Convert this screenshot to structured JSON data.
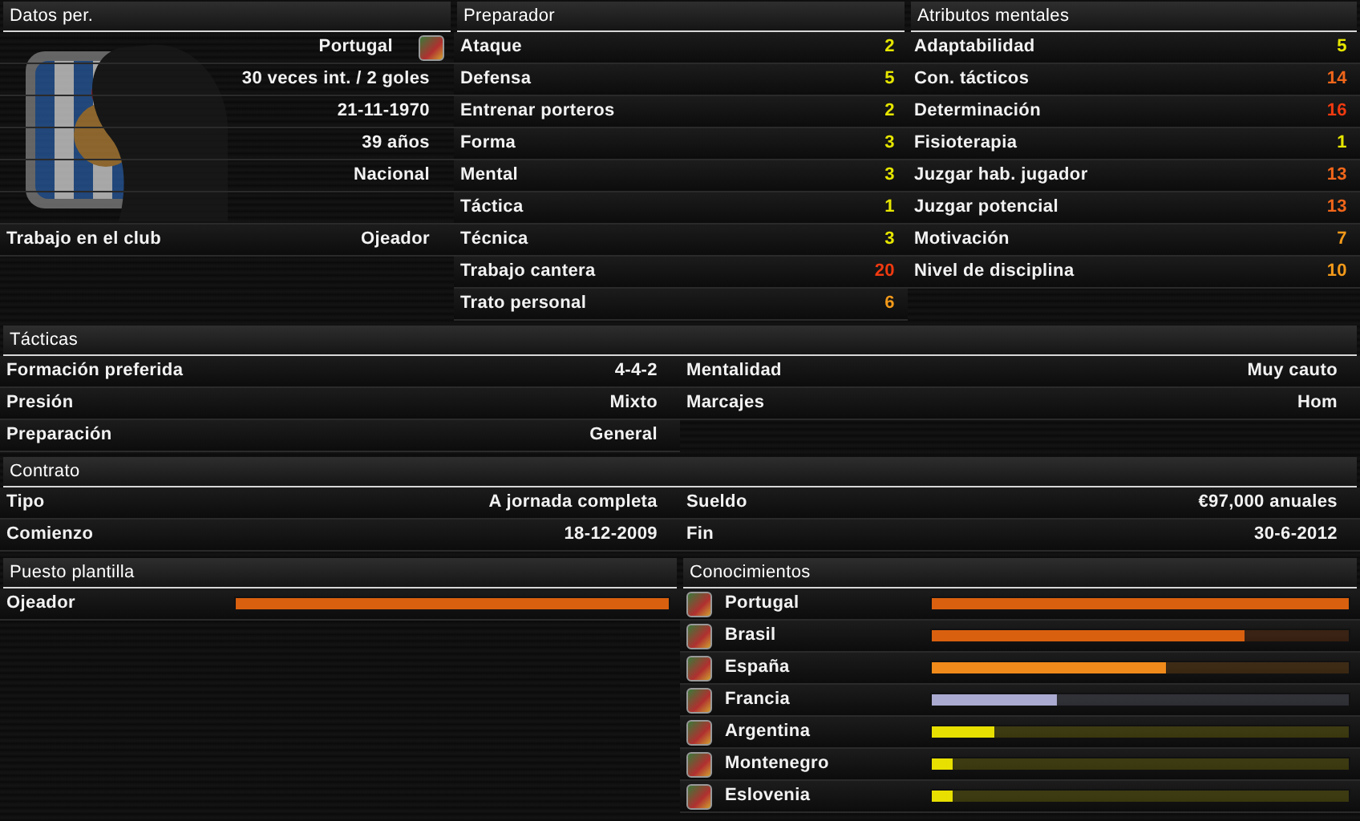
{
  "personal": {
    "title": "Datos per.",
    "rows": [
      {
        "kind": "nationality",
        "value": "Portugal"
      },
      {
        "kind": "value",
        "value": "30 veces int. / 2 goles"
      },
      {
        "kind": "value",
        "value": "21-11-1970"
      },
      {
        "kind": "value",
        "value": "39 años"
      },
      {
        "kind": "value",
        "value": "Nacional"
      },
      {
        "kind": "labeled",
        "label": "Trabajo en el club",
        "value": "Ojeador"
      }
    ]
  },
  "coach": {
    "title": "Preparador",
    "rows": [
      {
        "label": "Ataque",
        "value": "2",
        "color": "#e6e600"
      },
      {
        "label": "Defensa",
        "value": "5",
        "color": "#e6e600"
      },
      {
        "label": "Entrenar porteros",
        "value": "2",
        "color": "#e6e600"
      },
      {
        "label": "Forma",
        "value": "3",
        "color": "#e6e600"
      },
      {
        "label": "Mental",
        "value": "3",
        "color": "#e6e600"
      },
      {
        "label": "Táctica",
        "value": "1",
        "color": "#e6e600"
      },
      {
        "label": "Técnica",
        "value": "3",
        "color": "#e6e600"
      },
      {
        "label": "Trabajo cantera",
        "value": "20",
        "color": "#f03a10"
      },
      {
        "label": "Trato personal",
        "value": "6",
        "color": "#f39a1a"
      }
    ]
  },
  "mental": {
    "title": "Atributos mentales",
    "rows": [
      {
        "label": "Adaptabilidad",
        "value": "5",
        "color": "#e6e600"
      },
      {
        "label": "Con. tácticos",
        "value": "14",
        "color": "#f0661a"
      },
      {
        "label": "Determinación",
        "value": "16",
        "color": "#f03a10"
      },
      {
        "label": "Fisioterapia",
        "value": "1",
        "color": "#e6e600"
      },
      {
        "label": "Juzgar hab. jugador",
        "value": "13",
        "color": "#f0661a"
      },
      {
        "label": "Juzgar potencial",
        "value": "13",
        "color": "#f0661a"
      },
      {
        "label": "Motivación",
        "value": "7",
        "color": "#f39a1a"
      },
      {
        "label": "Nivel de disciplina",
        "value": "10",
        "color": "#f39a1a"
      }
    ]
  },
  "tactics": {
    "title": "Tácticas",
    "left": [
      {
        "label": "Formación preferida",
        "value": "4-4-2"
      },
      {
        "label": "Presión",
        "value": "Mixto"
      },
      {
        "label": "Preparación",
        "value": "General"
      }
    ],
    "right": [
      {
        "label": "Mentalidad",
        "value": "Muy cauto"
      },
      {
        "label": "Marcajes",
        "value": "Hom"
      }
    ]
  },
  "contract": {
    "title": "Contrato",
    "left": [
      {
        "label": "Tipo",
        "value": "A jornada completa"
      },
      {
        "label": "Comienzo",
        "value": "18-12-2009"
      }
    ],
    "right": [
      {
        "label": "Sueldo",
        "value": "€97,000 anuales"
      },
      {
        "label": "Fin",
        "value": "30-6-2012"
      }
    ]
  },
  "squad_role": {
    "title": "Puesto plantilla",
    "rows": [
      {
        "label": "Ojeador",
        "level": 1,
        "color": "#d9600f"
      }
    ]
  },
  "knowledge": {
    "title": "Conocimientos",
    "rows": [
      {
        "name": "Portugal",
        "level": 1,
        "color": "#d9600f"
      },
      {
        "name": "Brasil",
        "level": 0.75,
        "color": "#d9600f"
      },
      {
        "name": "España",
        "level": 0.56,
        "color": "#f08a1a"
      },
      {
        "name": "Francia",
        "level": 0.3,
        "color": "#aaaad0"
      },
      {
        "name": "Argentina",
        "level": 0.15,
        "color": "#e8e000"
      },
      {
        "name": "Montenegro",
        "level": 0.05,
        "color": "#e8e000"
      },
      {
        "name": "Eslovenia",
        "level": 0.05,
        "color": "#e8e000"
      }
    ]
  }
}
